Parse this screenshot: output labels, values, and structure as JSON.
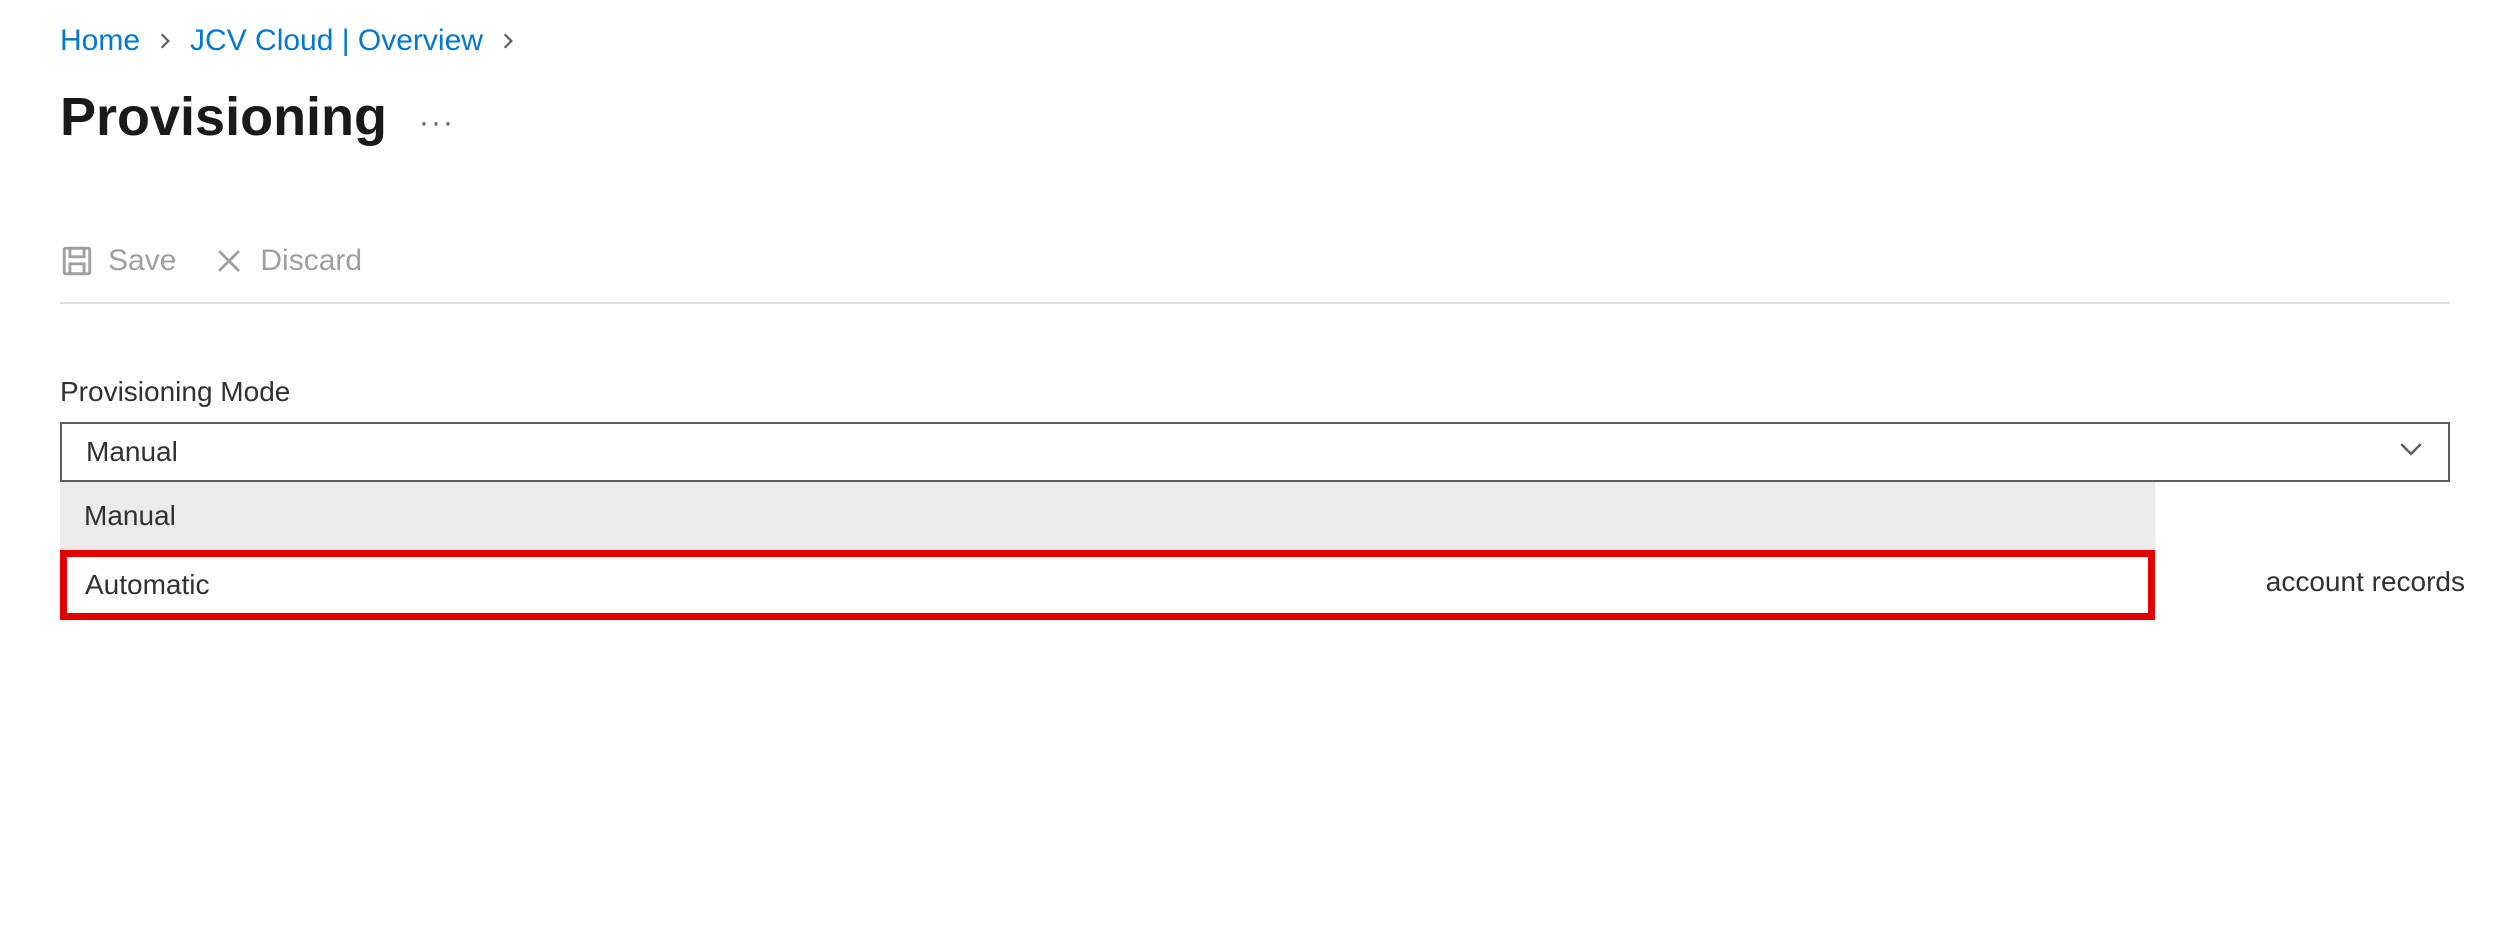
{
  "breadcrumb": {
    "home": "Home",
    "item2": "JCV Cloud | Overview"
  },
  "page": {
    "title": "Provisioning",
    "moreIndicator": "···"
  },
  "toolbar": {
    "save_label": "Save",
    "discard_label": "Discard"
  },
  "field": {
    "label": "Provisioning Mode",
    "selected": "Manual",
    "options": {
      "manual": "Manual",
      "automatic": "Automatic"
    }
  },
  "behind": {
    "text_fragment": "account records"
  }
}
